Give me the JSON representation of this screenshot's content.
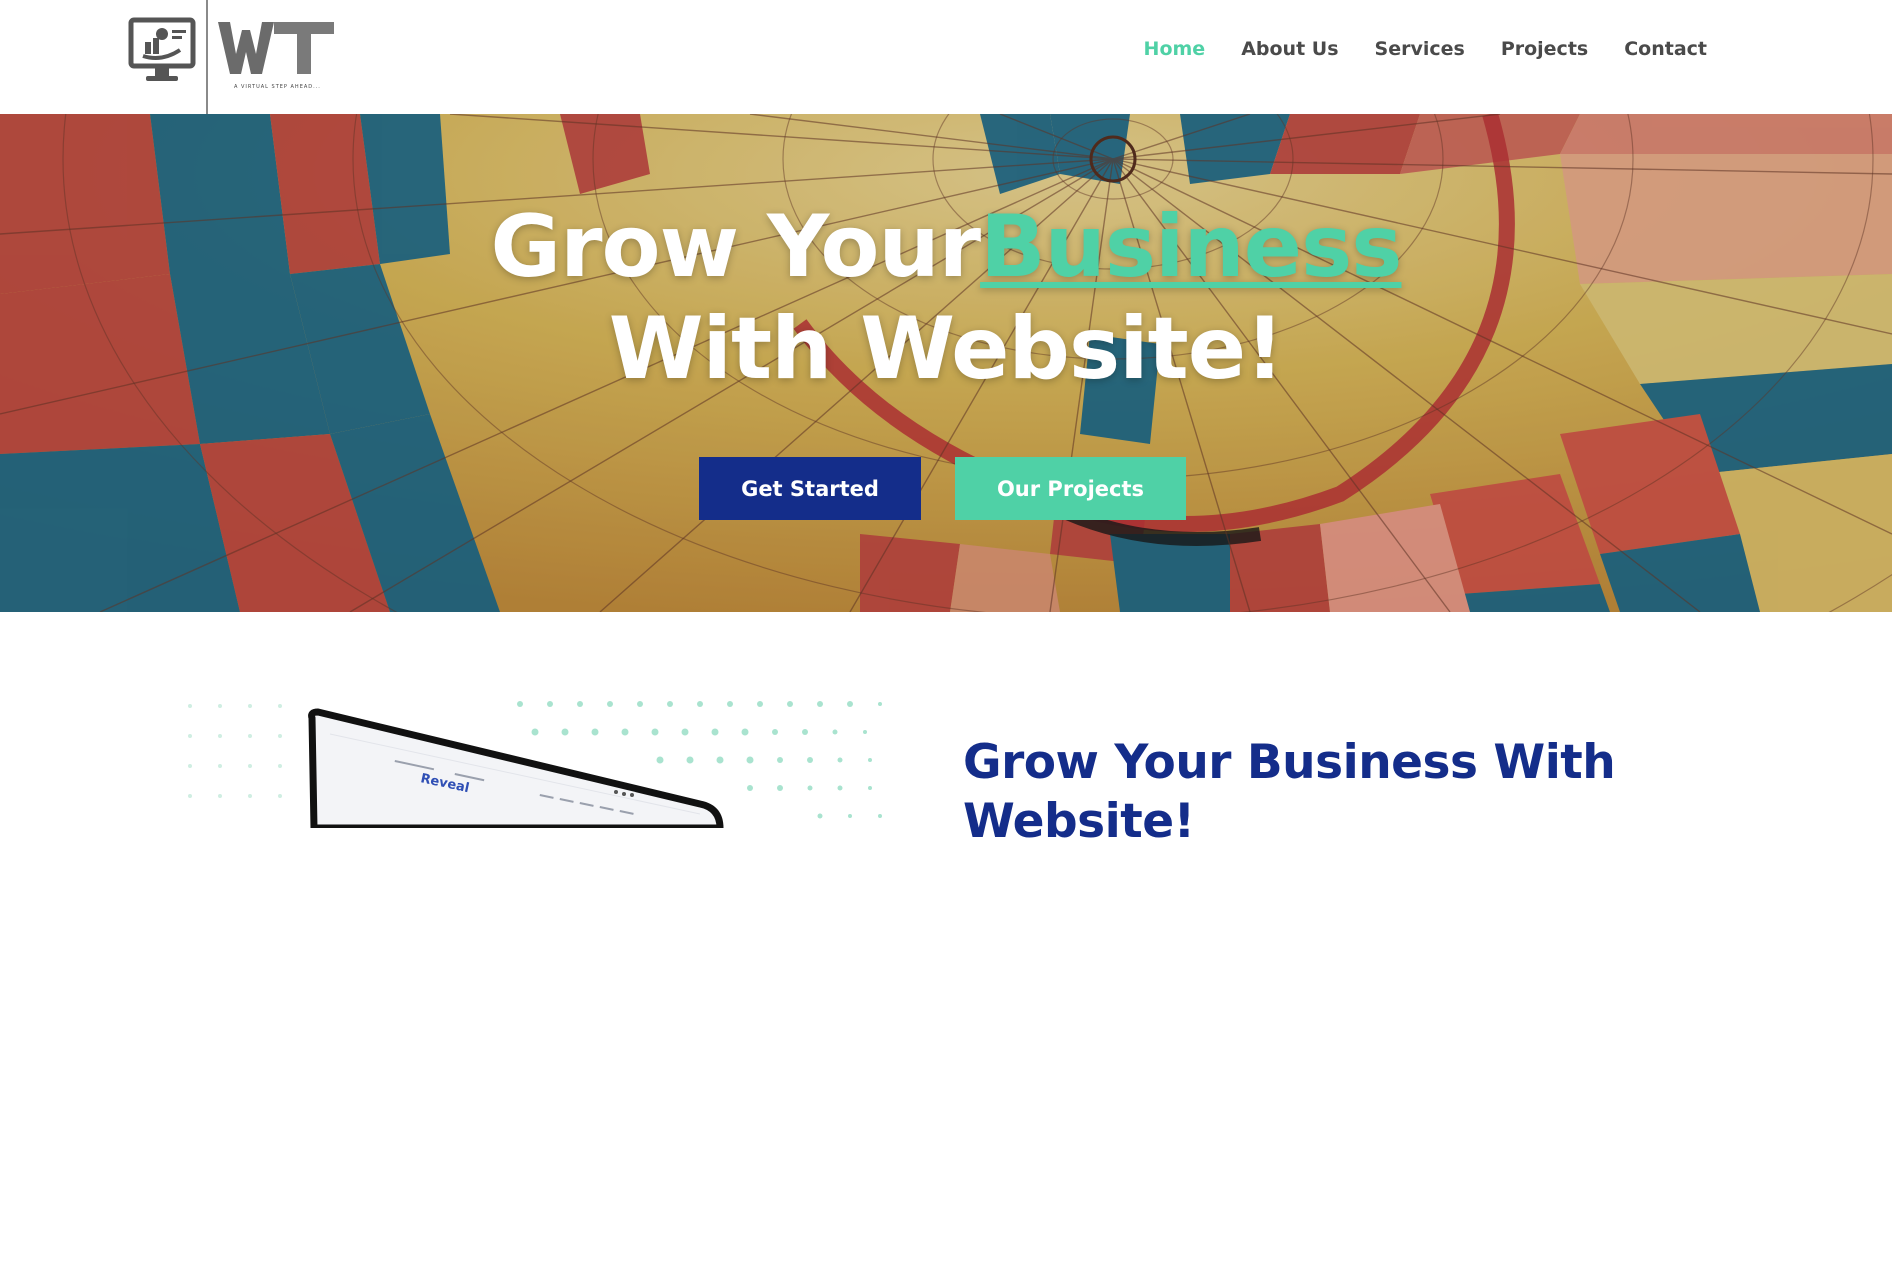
{
  "header": {
    "logo": {
      "mark": "WT",
      "tagline": "A VIRTUAL STEP AHEAD..."
    },
    "nav": [
      {
        "label": "Home",
        "active": true
      },
      {
        "label": "About Us",
        "active": false
      },
      {
        "label": "Services",
        "active": false
      },
      {
        "label": "Projects",
        "active": false
      },
      {
        "label": "Contact",
        "active": false
      }
    ]
  },
  "hero": {
    "title_part1": "Grow Your",
    "title_accent": "Business",
    "title_line2": "With Website!",
    "buttons": {
      "primary": "Get Started",
      "secondary": "Our Projects"
    }
  },
  "section": {
    "title": "Grow Your Business With Website!",
    "mockup_brand": "Reveal"
  },
  "colors": {
    "accent": "#4fd1a6",
    "primary": "#142d8a",
    "nav_text": "#4a4a4a"
  }
}
